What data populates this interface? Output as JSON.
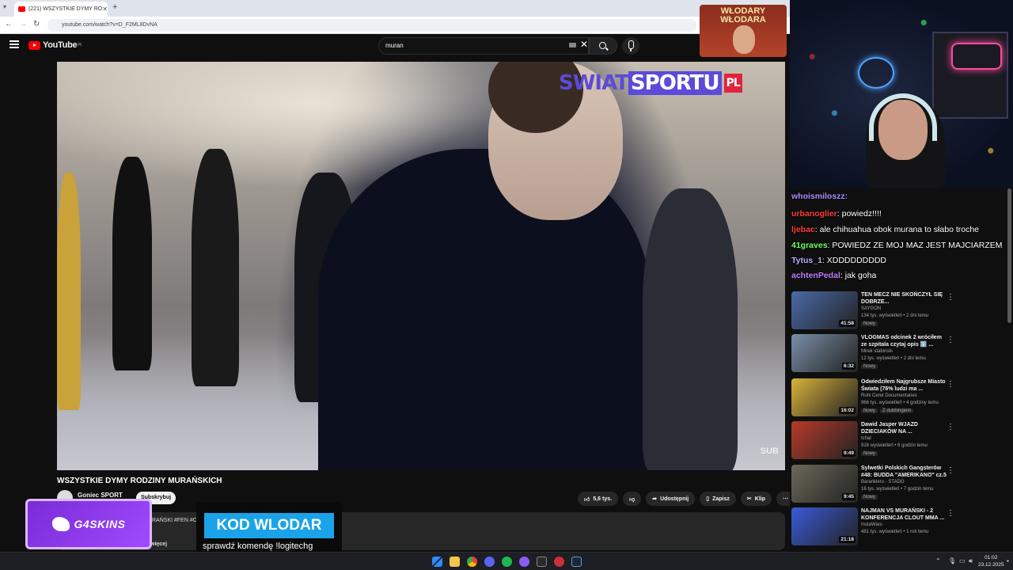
{
  "browser": {
    "tab_title": "(221) WSZYSTKIE DYMY RO",
    "tab_close": "✕",
    "new_tab": "+",
    "url": "youtube.com/watch?v=D_F2ML8DvNA"
  },
  "youtube": {
    "logo_text": "YouTube",
    "logo_region": "PL",
    "search_value": "muran",
    "clear_glyph": "✕"
  },
  "video": {
    "watermark_left": "SWIAT",
    "watermark_right": "SPORTU",
    "watermark_pl": "PL",
    "corner_text": "SUB",
    "title": "WSZYSTKIE DYMY RODZINY MURAŃSKICH",
    "channel": "Goniec SPORT",
    "subscribe": "Subskrybuj",
    "likes": "5,6 tys.",
    "share": "Udostępnij",
    "save": "Zapisz",
    "clip": "Klip",
    "more": "⋯",
    "desc_tags": "RAŃSKI #FEN #C",
    "desc_more": "więcej"
  },
  "overlays": {
    "g4_text": "G4SKINS",
    "kod_code": "KOD WLODAR",
    "kod_hint": "sprawdź komendę !logitechg",
    "cam_badge": "WŁODARY WŁODARA"
  },
  "chat": [
    {
      "user": "whoismiloszz:",
      "msg": "",
      "color": "#a88cff"
    },
    {
      "user": "urbanoglier",
      "msg": ": powiedz!!!!",
      "color": "#ff3a3a"
    },
    {
      "user": "ljebac",
      "msg": ": ale  chihuahua obok murana to słabo troche",
      "color": "#ff3a3a"
    },
    {
      "user": "41graves",
      "msg": ": POWIEDZ ZE MOJ MAZ JEST MAJCIARZEM",
      "color": "#6cff6c"
    },
    {
      "user": "Tytus_1",
      "msg": ": XDDDDDDDDD",
      "color": "#b9a6ff"
    },
    {
      "user": "achtenPedal",
      "msg": ": jak goha",
      "color": "#c27dff"
    }
  ],
  "recommendations": [
    {
      "title": "TEN MECZ NIE SKOŃCZYŁ SIĘ DOBRZE...",
      "channel": "SAYGON",
      "meta": "134 tys. wyświetleń • 2 dni temu",
      "badge": "Nowy",
      "dub": "",
      "duration": "41:58",
      "color": "#4b6aa8"
    },
    {
      "title": "VLOGMAS odcinek 2 wróciłem ze szpitala czytaj opis ℹ️ ...",
      "channel": "Mirek stabinski",
      "meta": "12 tys. wyświetleń • 2 dni temu",
      "badge": "Nowy",
      "dub": "",
      "duration": "6:32",
      "color": "#7a8fa8"
    },
    {
      "title": "Odwiedziłem Najgrubsze Miasto Świata (76% ludzi ma ...",
      "channel": "Rohi Ceret Documentaries",
      "meta": "966 tys. wyświetleń • 4 godziny temu",
      "badge": "Nowy",
      "dub": "Z dubbingiem",
      "duration": "16:02",
      "color": "#d9b23a"
    },
    {
      "title": "Dawid Jasper WJAZD DZIECIAKÓW NA ...",
      "channel": "Ichal",
      "meta": "916 wyświetleń • 6 godzin temu",
      "badge": "Nowy",
      "dub": "",
      "duration": "9:49",
      "color": "#b83a2a"
    },
    {
      "title": "Sylwetki Polskich Gangsterów #48: BUDDA \"AMERIKANO\" cz.5",
      "channel": "Barankiero - STADO",
      "meta": "16 tys. wyświetleń • 7 godzin temu",
      "badge": "Nowy",
      "dub": "",
      "duration": "9:45",
      "color": "#6b6a5a"
    },
    {
      "title": "NAJMAN VS MURAŃSKI - 2 KONFERENCJA CLOUT MMA ...",
      "channel": "InstaWars",
      "meta": "481 tys. wyświetleń • 1 rok temu",
      "badge": "",
      "dub": "",
      "duration": "21:18",
      "color": "#3a5ad8"
    }
  ],
  "taskbar": {
    "time": "01:02",
    "date": "23.12.2025"
  }
}
